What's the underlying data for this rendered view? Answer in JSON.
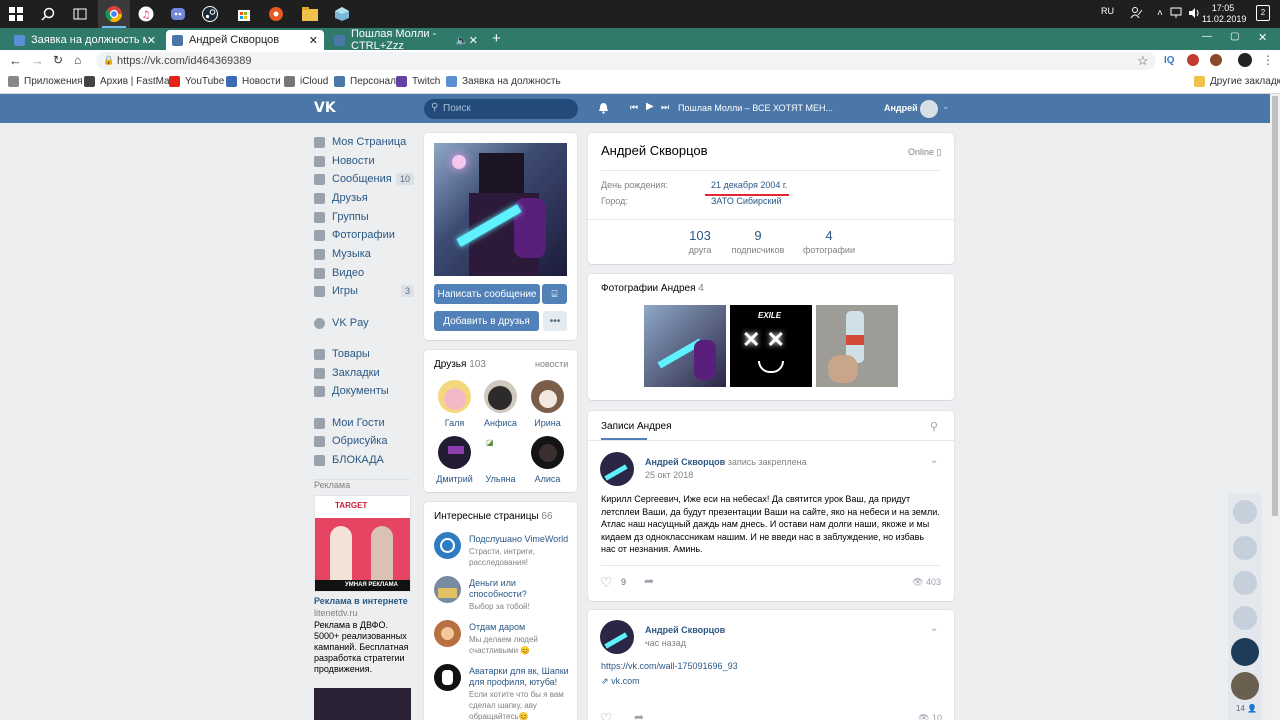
{
  "taskbar": {
    "lang": "RU",
    "time": "17:05",
    "date": "11.02.2019",
    "notif_count": "2"
  },
  "tabs": [
    {
      "label": "Заявка на должность модерато"
    },
    {
      "label": "Андрей Скворцов"
    },
    {
      "label": "Пошлая Молли - CTRL+Zzz"
    }
  ],
  "browser": {
    "url": "https://vk.com/id464369389"
  },
  "bookmarks": [
    "Приложения",
    "Архив | FastMail",
    "YouTube",
    "Новости",
    "iCloud",
    "Персонал",
    "Twitch",
    "Заявка на должность"
  ],
  "bookmarks_other": "Другие закладки",
  "header": {
    "search_placeholder": "Поиск",
    "player_track": "Пошлая Молли – ВСЕ ХОТЯТ МЕН...",
    "username": "Андрей"
  },
  "nav": [
    {
      "label": "Моя Страница"
    },
    {
      "label": "Новости"
    },
    {
      "label": "Сообщения",
      "badge": "10"
    },
    {
      "label": "Друзья"
    },
    {
      "label": "Группы"
    },
    {
      "label": "Фотографии"
    },
    {
      "label": "Музыка"
    },
    {
      "label": "Видео"
    },
    {
      "label": "Игры",
      "badge": "3"
    },
    {
      "label": "VK Pay"
    },
    {
      "label": "Товары"
    },
    {
      "label": "Закладки"
    },
    {
      "label": "Документы"
    },
    {
      "label": "Мои Гости"
    },
    {
      "label": "Обрисуйка"
    },
    {
      "label": "БЛОКАДА"
    }
  ],
  "ads": {
    "heading": "Реклама",
    "title": "Реклама в интернете",
    "domain": "litenetdv.ru",
    "text": "Реклама в ДВФО. 5000+ реализованных кампаний. Бесплатная разработка стратегии продвижения.",
    "banner_brand": "TARGET",
    "banner_tag": "УМНАЯ РЕКЛАМА"
  },
  "profile": {
    "name": "Андрей Скворцов",
    "status": "Online",
    "birthday_label": "День рождения:",
    "birthday": "21 декабря 2004 г.",
    "city_label": "Город:",
    "city": "ЗАТО Сибирский",
    "counters": [
      {
        "value": "103",
        "label": "друга"
      },
      {
        "value": "9",
        "label": "подписчиков"
      },
      {
        "value": "4",
        "label": "фотографии"
      }
    ],
    "send_message": "Написать сообщение",
    "add_friend": "Добавить в друзья"
  },
  "friends": {
    "title": "Друзья",
    "count": "103",
    "link": "новости",
    "items": [
      "Галя",
      "Анфиса",
      "Ирина",
      "Дмитрий",
      "Ульяна",
      "Алиса"
    ]
  },
  "photos": {
    "title": "Фотографии Андрея",
    "count": "4",
    "exile_label": "EXILE"
  },
  "interesting": {
    "title": "Интересные страницы",
    "count": "66",
    "items": [
      {
        "name": "Подслушано VimeWorld",
        "desc": "Страсти, интриги, расследования!"
      },
      {
        "name": "Деньги или способности?",
        "desc": "Выбор за тобой!"
      },
      {
        "name": "Отдам даром",
        "desc": "Мы делаем людей счастливыми 😊"
      },
      {
        "name": "Аватарки для вк, Шапки для профиля, ютуба!",
        "desc": "Если хотите что бы я вам сделал шапку, аву обращайтесь😊"
      }
    ]
  },
  "wall": {
    "title": "Записи Андрея",
    "posts": [
      {
        "author": "Андрей Скворцов",
        "pinned": "запись закреплена",
        "date": "25 окт 2018",
        "text": "Кирилл Сергеевич, Иже еси на небесах! Да святится урок Ваш, да придут летсплеи Ваши, да будут презентации Ваши на сайте, яко на небеси и на земли. Атлас наш насущный даждь нам днесь. И остави нам долги наши, якоже и мы кидаем дз одноклассникам нашим. И не введи нас в заблуждение, но избавь нас от незнания. Аминь.",
        "likes": "9",
        "views": "403"
      },
      {
        "author": "Андрей Скворцов",
        "date": "час назад",
        "link": "https://vk.com/wall-175091696_93",
        "domain": "vk.com",
        "views": "10"
      }
    ]
  },
  "right_rail": {
    "count": "14"
  }
}
